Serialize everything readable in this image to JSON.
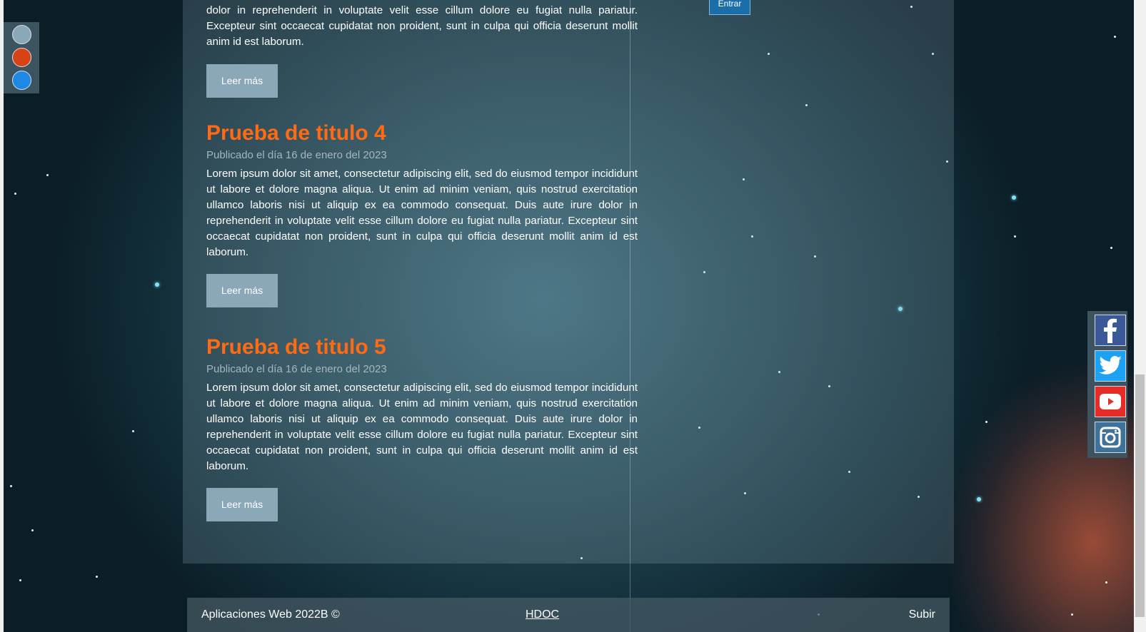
{
  "login": {
    "button_label": "Entrar"
  },
  "theme_picker": {
    "colors": [
      "#8aa8b8",
      "#d84315",
      "#1e88e5"
    ]
  },
  "posts": [
    {
      "title": "",
      "date": "",
      "body": "dolor in reprehenderit in voluptate velit esse cillum dolore eu fugiat nulla pariatur. Excepteur sint occaecat cupidatat non proident, sunt in culpa qui officia deserunt mollit anim id est laborum.",
      "button": "Leer más"
    },
    {
      "title": "Prueba de titulo 4",
      "date": "Publicado el día 16 de enero del 2023",
      "body": "Lorem ipsum dolor sit amet, consectetur adipiscing elit, sed do eiusmod tempor incididunt ut labore et dolore magna aliqua. Ut enim ad minim veniam, quis nostrud exercitation ullamco laboris nisi ut aliquip ex ea commodo consequat. Duis aute irure dolor in reprehenderit in voluptate velit esse cillum dolore eu fugiat nulla pariatur. Excepteur sint occaecat cupidatat non proident, sunt in culpa qui officia deserunt mollit anim id est laborum.",
      "button": "Leer más"
    },
    {
      "title": "Prueba de titulo 5",
      "date": "Publicado el día 16 de enero del 2023",
      "body": "Lorem ipsum dolor sit amet, consectetur adipiscing elit, sed do eiusmod tempor incididunt ut labore et dolore magna aliqua. Ut enim ad minim veniam, quis nostrud exercitation ullamco laboris nisi ut aliquip ex ea commodo consequat. Duis aute irure dolor in reprehenderit in voluptate velit esse cillum dolore eu fugiat nulla pariatur. Excepteur sint occaecat cupidatat non proident, sunt in culpa qui officia deserunt mollit anim id est laborum.",
      "button": "Leer más"
    }
  ],
  "social": [
    {
      "icon": "facebook-icon",
      "color": "#3b5998",
      "glyph": "f"
    },
    {
      "icon": "twitter-icon",
      "color": "#1da1f2"
    },
    {
      "icon": "youtube-icon",
      "color": "#e52d27"
    },
    {
      "icon": "instagram-icon",
      "color": "#3f729b"
    }
  ],
  "footer": {
    "copyright": "Aplicaciones Web 2022B ©",
    "link": "HDOC",
    "top_link": "Subir"
  }
}
